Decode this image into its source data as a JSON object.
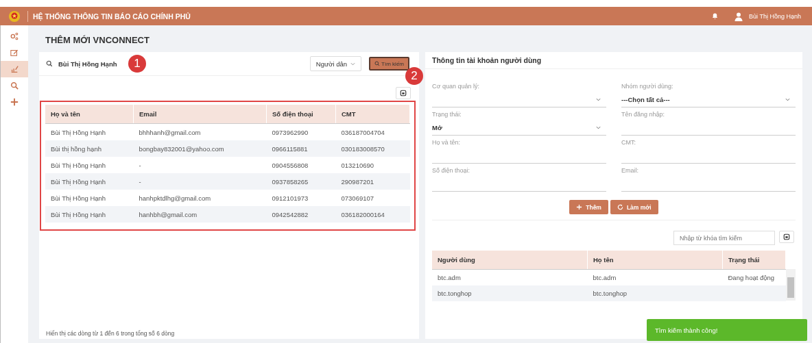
{
  "header": {
    "title": "HỆ THỐNG THÔNG TIN BÁO CÁO CHÍNH PHỦ",
    "user": "Bùi Thị Hồng Hạnh"
  },
  "sidebar": {
    "items": [
      {
        "kind": "share",
        "selected": false
      },
      {
        "kind": "edit",
        "selected": false
      },
      {
        "kind": "report",
        "selected": true
      },
      {
        "kind": "search",
        "selected": false
      },
      {
        "kind": "add",
        "selected": false
      }
    ]
  },
  "page_title": "THÊM MỚI VNCONNECT",
  "search": {
    "value": "Bùi Thị Hồng Hạnh",
    "filter": "Người dân",
    "button": "Tìm kiếm"
  },
  "callouts": [
    "1",
    "2"
  ],
  "results": {
    "columns": [
      "Họ và tên",
      "Email",
      "Số điện thoại",
      "CMT"
    ],
    "rows": [
      [
        "Bùi Thị Hồng Hạnh",
        "bhhhanh@gmail.com",
        "0973962990",
        "036187004704"
      ],
      [
        "Bùi thị hồng hạnh",
        "bongbay832001@yahoo.com",
        "0966115881",
        "030183008570"
      ],
      [
        "Bùi Thị Hồng Hạnh",
        "-",
        "0904556808",
        "013210690"
      ],
      [
        "Bùi Thị Hồng Hạnh",
        "-",
        "0937858265",
        "290987201"
      ],
      [
        "Bùi Thị Hồng Hạnh",
        "hanhpktdlhg@gmail.com",
        "0912101973",
        "073069107"
      ],
      [
        "Bùi Thị Hồng Hạnh",
        "hanhbh@gmail.com",
        "0942542882",
        "036182000164"
      ]
    ],
    "footer": "Hiển thị các dòng từ 1 đến 6 trong tổng số 6 dòng"
  },
  "account_form": {
    "title": "Thông tin tài khoản người dùng",
    "fields": [
      {
        "label": "Cơ quan quản lý:",
        "kind": "select"
      },
      {
        "label": "Nhóm người dùng:",
        "kind": "select",
        "value": "---Chọn tất cả---"
      },
      {
        "label": "Trạng thái:",
        "kind": "select",
        "value": "Mở"
      },
      {
        "label": "Tên đăng nhập:",
        "kind": "text"
      },
      {
        "label": "Họ và tên:",
        "kind": "text"
      },
      {
        "label": "CMT:",
        "kind": "text"
      },
      {
        "label": "Số điện thoại:",
        "kind": "text"
      },
      {
        "label": "Email:",
        "kind": "text"
      }
    ],
    "buttons": [
      {
        "label": "Thêm",
        "kind": "add"
      },
      {
        "label": "Làm mới",
        "kind": "refresh"
      }
    ]
  },
  "user_table": {
    "search_placeholder": "Nhập từ khóa tìm kiếm",
    "columns": [
      "Người dùng",
      "Họ tên",
      "Trạng thái"
    ],
    "rows": [
      [
        "btc.adm",
        "btc.adm",
        "Đang hoạt động"
      ],
      [
        "btc.tonghop",
        "btc.tonghop"
      ]
    ]
  },
  "toast": "Tìm kiếm thành công!"
}
